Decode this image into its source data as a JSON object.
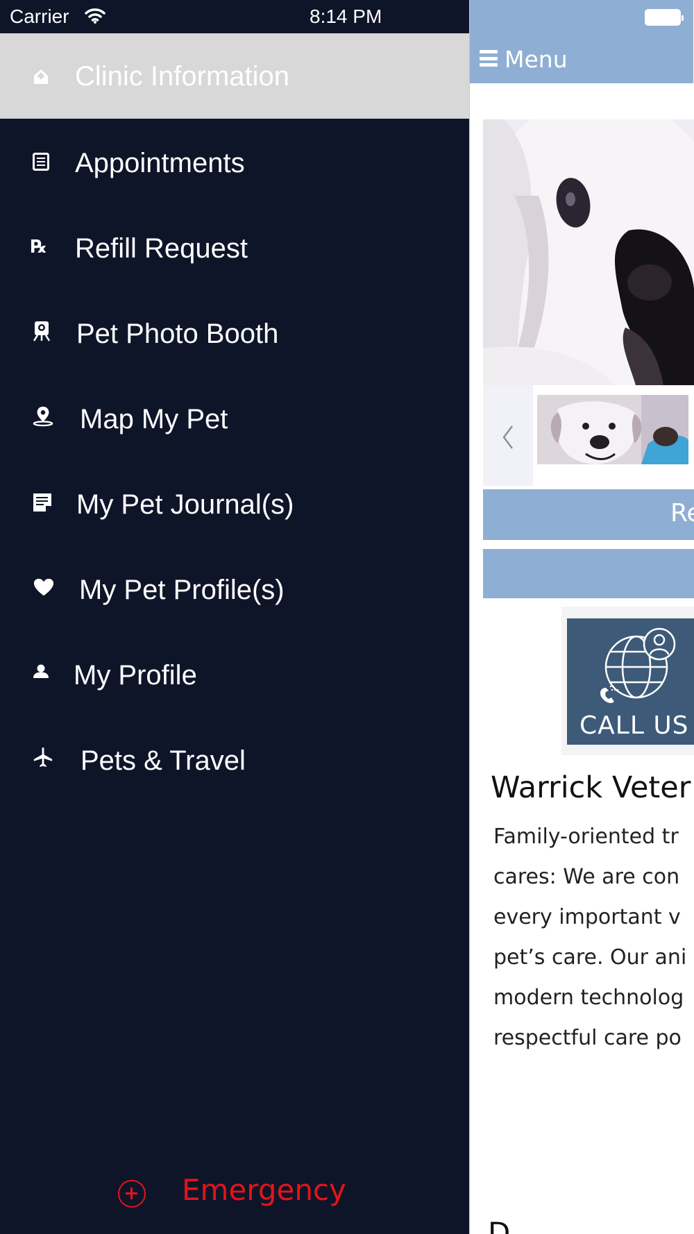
{
  "status_bar": {
    "carrier": "Carrier",
    "time": "8:14 PM"
  },
  "drawer": {
    "background": "#0f1529",
    "active_background": "#d8d8d8",
    "items": [
      {
        "label": "Clinic Information",
        "icon": "clinic-icon",
        "active": true
      },
      {
        "label": "Appointments",
        "icon": "list-icon"
      },
      {
        "label": "Refill Request",
        "icon": "rx-icon"
      },
      {
        "label": "Pet Photo Booth",
        "icon": "photo-booth-icon"
      },
      {
        "label": "Map My Pet",
        "icon": "map-pin-icon"
      },
      {
        "label": "My Pet Journal(s)",
        "icon": "journal-icon"
      },
      {
        "label": "My Pet Profile(s)",
        "icon": "heart-icon"
      },
      {
        "label": "My Profile",
        "icon": "person-icon"
      },
      {
        "label": "Pets & Travel",
        "icon": "airplane-icon"
      }
    ],
    "emergency": {
      "label": "Emergency",
      "icon": "plus-circle-icon",
      "color": "#e3141b"
    }
  },
  "content": {
    "topbar_color": "#8faed3",
    "menu_label": "Menu",
    "button1_label": "Re",
    "call_us_label": "CALL US",
    "clinic_title": "Warrick Veter",
    "description_lines": [
      "Family-oriented tr",
      "cares: We are con",
      "every important v",
      "pet’s care. Our ani",
      "modern technolog",
      "respectful care po"
    ],
    "bottom_heading": "D"
  }
}
